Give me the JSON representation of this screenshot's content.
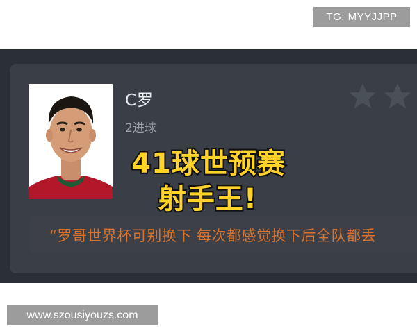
{
  "watermarks": {
    "top": "TG: MYYJJPP",
    "bottom": "www.szousiyouzs.com"
  },
  "player": {
    "name": "C罗",
    "goals": "2进球",
    "rating_stars_visible": 2,
    "photo": "player-portrait"
  },
  "quote": "“罗哥世界杯可别换下 每次都感觉换下后全队都丢",
  "headline": {
    "line1": "41球世预赛",
    "line2": "射手王!"
  },
  "colors": {
    "screen_bg": "#2b2f36",
    "card_bg": "#393e47",
    "quote_text": "#d9722c",
    "headline_fill": "#ffd32a",
    "headline_stroke": "#111111",
    "star": "#4a5058"
  },
  "icons": [
    "star-icon",
    "star-icon"
  ]
}
